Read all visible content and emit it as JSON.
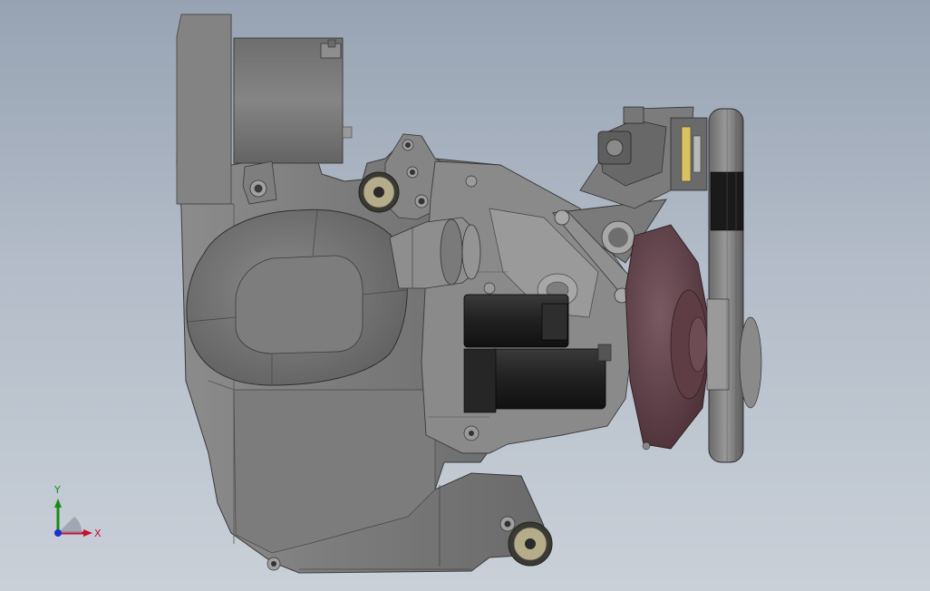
{
  "colors": {
    "background_top": "#97a3b3",
    "background_bottom": "#c9d0d8",
    "housing": "#7a7a7a",
    "housing_dark": "#5e5e5e",
    "housing_light": "#a3a3a3",
    "black_part": "#1f1f1f",
    "clutch_maroon": "#5a3a42",
    "bushing_ring": "#b5ad8a",
    "axis_x": "#c8102e",
    "axis_y": "#1a8a1a",
    "axis_z": "#1a2fd0"
  },
  "triad": {
    "x_label": "X",
    "y_label": "Y"
  }
}
